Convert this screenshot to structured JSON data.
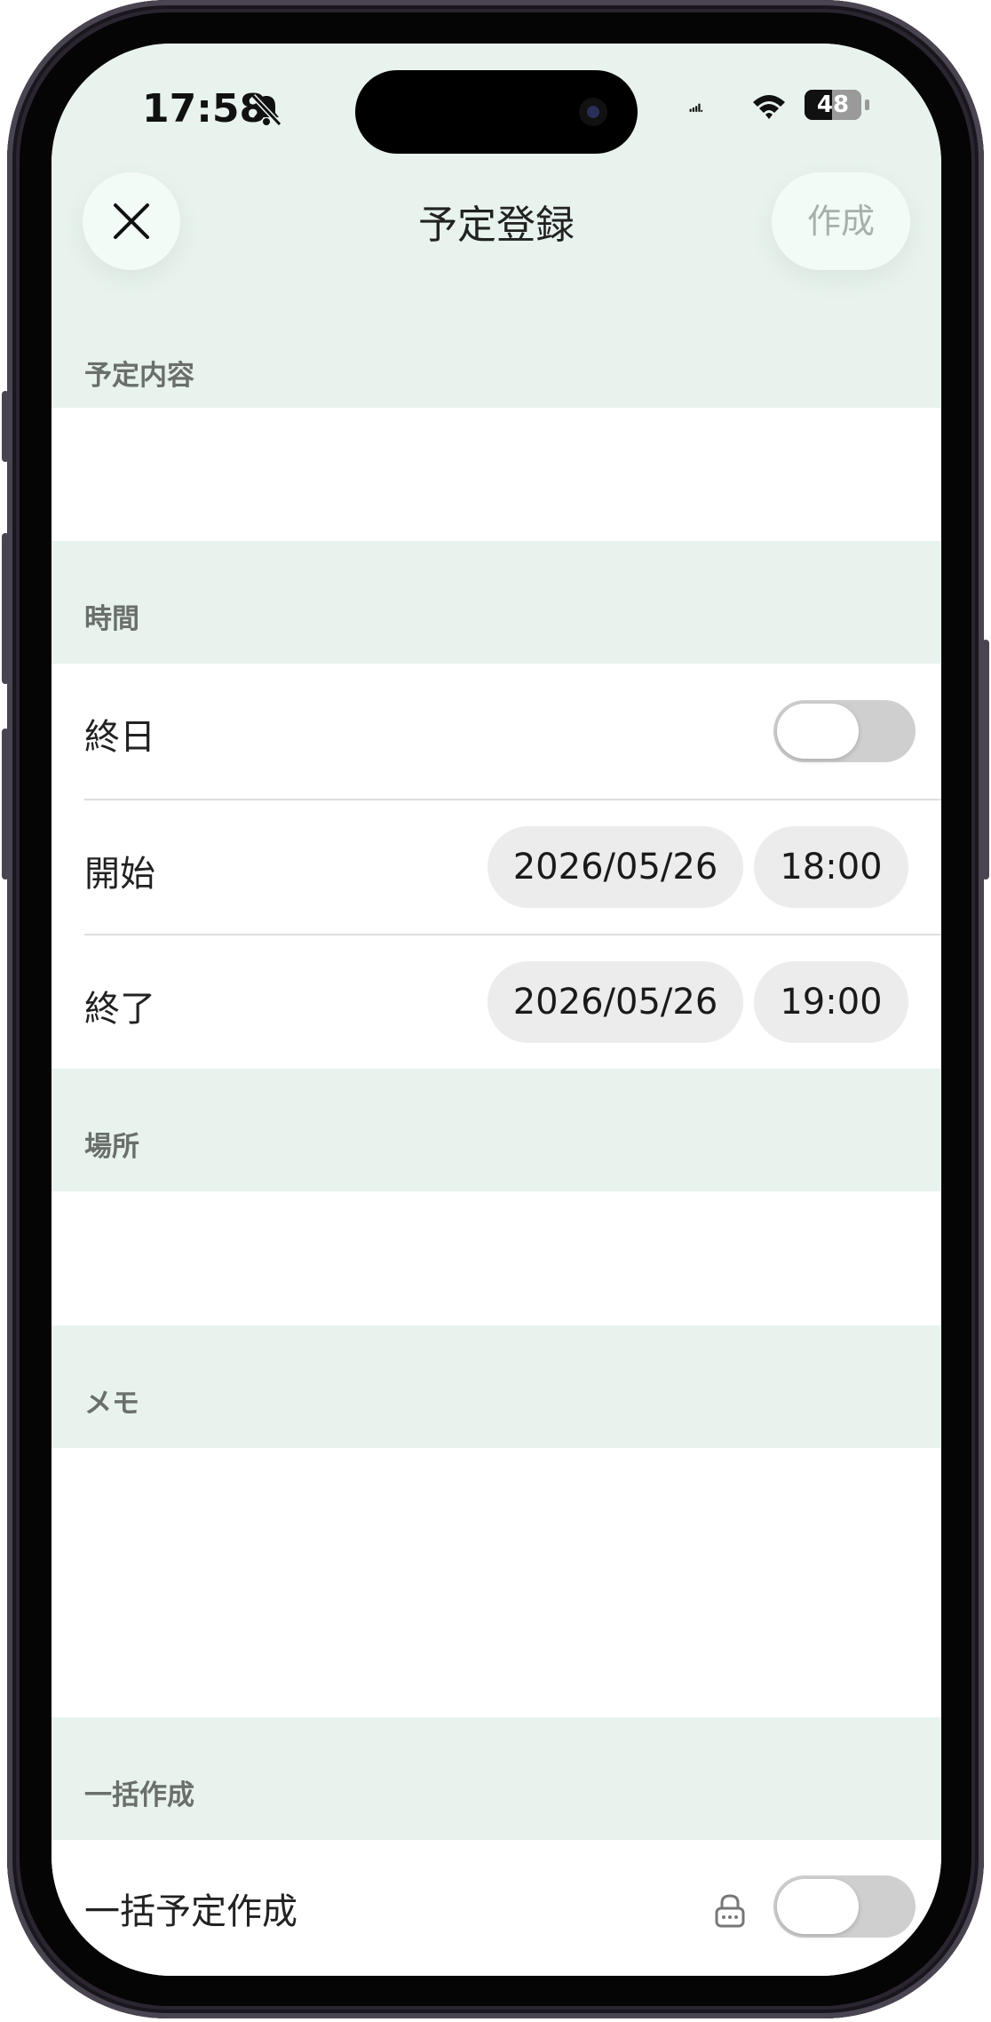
{
  "status_bar": {
    "time": "17:58",
    "battery_percent": "48",
    "battery_level": 0.48,
    "icons": [
      "bell-muted-icon",
      "cellular-icon",
      "wifi-icon",
      "battery-icon"
    ]
  },
  "nav": {
    "close_icon": "close-icon",
    "title": "予定登録",
    "create_label": "作成"
  },
  "sections": {
    "content": {
      "title": "予定内容",
      "value": ""
    },
    "time": {
      "title": "時間",
      "all_day": {
        "label": "終日",
        "on": false
      },
      "start": {
        "label": "開始",
        "date": "2026/05/26",
        "time": "18:00"
      },
      "end": {
        "label": "終了",
        "date": "2026/05/26",
        "time": "19:00"
      }
    },
    "location": {
      "title": "場所",
      "value": ""
    },
    "memo": {
      "title": "メモ",
      "value": ""
    },
    "bulk": {
      "title": "一括作成",
      "row_label": "一括予定作成",
      "lock_icon": "lock-icon",
      "on": false
    }
  },
  "colors": {
    "header_bg": "#e8f3ed",
    "button_bg": "#f2fbf6",
    "pill_bg": "#ececec",
    "toggle_off": "#cfcfcf"
  }
}
